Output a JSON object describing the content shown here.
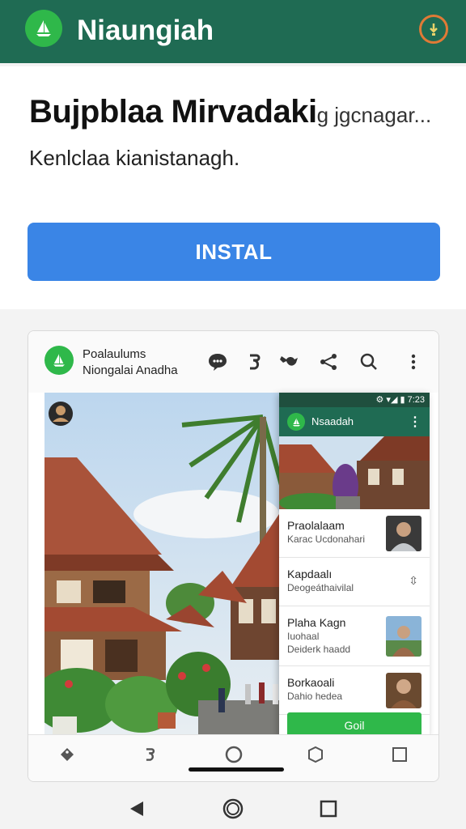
{
  "app": {
    "title": "Niaungiah"
  },
  "card": {
    "heading": "Bujpblaa Mirvadaki",
    "heading_tail": "g jgcnagar...",
    "subtitle": "Kenlclaa kianistanagh.",
    "install_label": "INSTAL"
  },
  "preview": {
    "header_line1": "Poalaulums",
    "header_line2": "Niongalai Anadha",
    "toolbar_icons": [
      "chat-icon",
      "hook-icon",
      "whale-icon",
      "share-icon",
      "search-icon",
      "more-vert-icon"
    ],
    "phone": {
      "status_text": "⚙ ▾◢ ▮ 7:23",
      "title": "Nsaadah",
      "list": [
        {
          "title": "Praolalaam",
          "line2": "Karac Ucdonahari",
          "thumb": "person"
        },
        {
          "title": "Kapdaalı",
          "line2": "Deogeáthaivilal",
          "thumb": "arrows"
        },
        {
          "title": "Plaha Kagn",
          "line2": "Iuohaal",
          "line3": "Deiderk haadd",
          "thumb": "person-outdoor"
        },
        {
          "title": "Borkaoali",
          "line2": "Dahio hedea",
          "thumb": "person-indoor"
        }
      ],
      "action_label": "Goil"
    },
    "nav_icons": [
      "tag-icon",
      "hook-icon",
      "home-circle-icon",
      "hexagon-icon",
      "square-icon"
    ]
  },
  "system_nav": [
    "back-icon",
    "home-icon",
    "recents-icon"
  ],
  "colors": {
    "appbar": "#1f6b53",
    "accent_green": "#2fb84a",
    "install_blue": "#3a85e6",
    "download_ring": "#e07a36"
  }
}
